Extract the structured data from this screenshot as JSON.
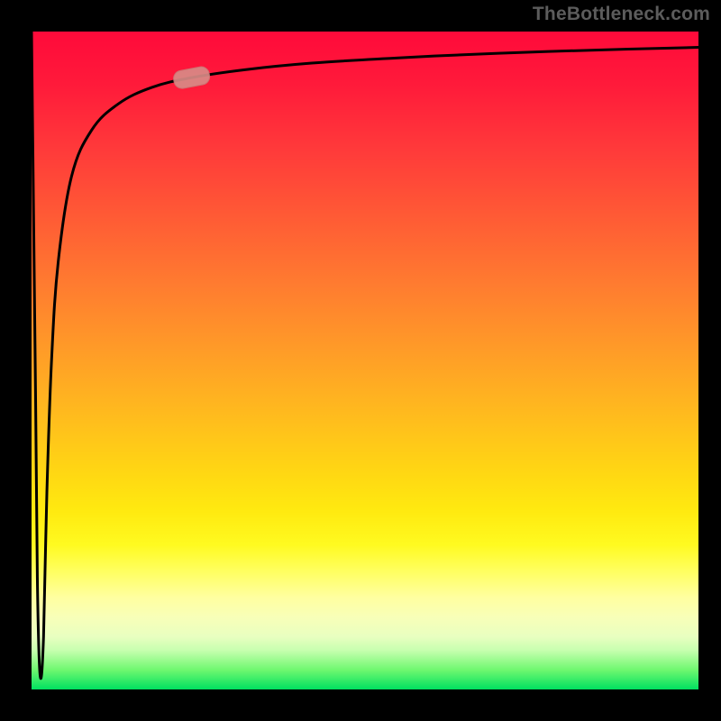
{
  "watermark": "TheBottleneck.com",
  "chart_data": {
    "type": "line",
    "title": "",
    "xlabel": "",
    "ylabel": "",
    "xlim": [
      0,
      100
    ],
    "ylim": [
      0,
      100
    ],
    "x": [
      0,
      0.6,
      0.9,
      1.3,
      1.8,
      2.3,
      3,
      4,
      6,
      9,
      13,
      18,
      24,
      32,
      42,
      55,
      70,
      85,
      100
    ],
    "values": [
      100,
      45,
      15,
      2,
      8,
      30,
      50,
      65,
      78,
      85,
      89,
      91.5,
      93,
      94.2,
      95.2,
      96,
      96.7,
      97.2,
      97.6
    ],
    "marker": {
      "x": 24,
      "y": 93
    }
  },
  "colors": {
    "curve": "#000000",
    "marker_fill": "#d88a86",
    "marker_stroke": "#c97a76"
  }
}
